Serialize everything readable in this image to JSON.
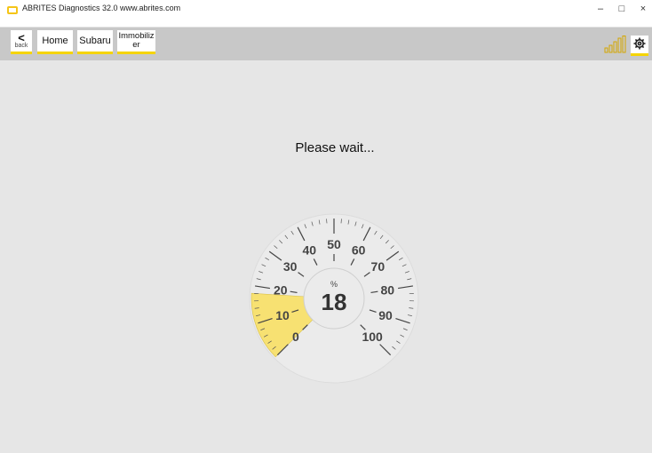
{
  "window": {
    "title": "ABRITES Diagnostics 32.0 www.abrites.com",
    "controls": [
      "–",
      "□",
      "×"
    ]
  },
  "toolbar": {
    "back_arrow": "<",
    "back_label": "back",
    "items": [
      "Home",
      "Subaru",
      "Immobiliz\ner"
    ]
  },
  "status": {
    "message": "Please wait..."
  },
  "gauge": {
    "unit": "%",
    "value": 18,
    "value_label": "18",
    "min": 0,
    "max": 100,
    "ticks": [
      "0",
      "10",
      "20",
      "30",
      "40",
      "50",
      "60",
      "70",
      "80",
      "90",
      "100"
    ],
    "fill_color": "#f7e172"
  },
  "icons": {
    "signal": "signal-strength-icon",
    "settings": "gear-icon"
  },
  "colors": {
    "accent": "#f5d400"
  }
}
